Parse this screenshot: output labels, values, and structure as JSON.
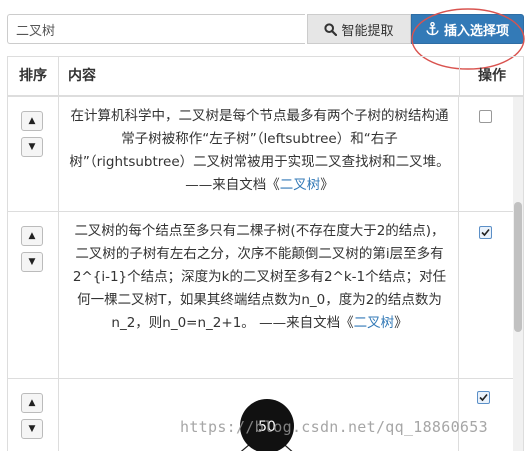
{
  "search": {
    "value": "二叉树"
  },
  "toolbar": {
    "smart_label": "智能提取",
    "insert_label": "插入选择项",
    "smart_icon": "search-icon",
    "insert_icon": "anchor-icon"
  },
  "table": {
    "headers": {
      "sort": "排序",
      "content": "内容",
      "op": "操作"
    },
    "rows": [
      {
        "text": "在计算机科学中，二叉树是每个节点最多有两个子树的树结构通常子树被称作“左子树”（leftsubtree）和“右子树”（rightsubtree）二叉树常被用于实现二叉查找树和二叉堆。 ——来自文档《",
        "link": "二叉树",
        "suffix": "》",
        "checked": false
      },
      {
        "text": "二叉树的每个结点至多只有二棵子树(不存在度大于2的结点)，二叉树的子树有左右之分，次序不能颠倒二叉树的第i层至多有2^{i-1}个结点；深度为k的二叉树至多有2^k-1个结点；对任何一棵二叉树T，如果其终端结点数为n_0，度为2的结点数为n_2，则n_0=n_2+1。 ——来自文档《",
        "link": "二叉树",
        "suffix": "》",
        "checked": true
      },
      {
        "image_node_label": "50",
        "checked": true
      }
    ]
  },
  "watermark": "https://blog.csdn.net/qq_18860653",
  "colors": {
    "primary": "#337ab7",
    "annotation": "#d9534f"
  }
}
